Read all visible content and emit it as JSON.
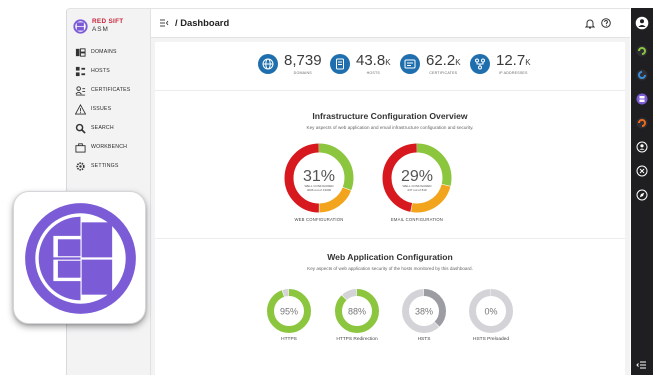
{
  "brand": {
    "name": "RED SIFT",
    "product": "ASM",
    "accent": "#c8253c",
    "logo_color": "#7b5cd6"
  },
  "sidebar": {
    "items": [
      {
        "label": "DOMAINS",
        "icon": "domains-icon"
      },
      {
        "label": "HOSTS",
        "icon": "hosts-icon"
      },
      {
        "label": "CERTIFICATES",
        "icon": "certificates-icon"
      },
      {
        "label": "ISSUES",
        "icon": "warning-icon"
      },
      {
        "label": "SEARCH",
        "icon": "search-icon"
      },
      {
        "label": "WORKBENCH",
        "icon": "workbench-icon"
      },
      {
        "label": "SETTINGS",
        "icon": "gear-icon"
      }
    ]
  },
  "header": {
    "breadcrumb": "/ Dashboard"
  },
  "stats": [
    {
      "value": "8,739",
      "suffix": "",
      "label": "DOMAINS",
      "icon": "globe-icon"
    },
    {
      "value": "43.8",
      "suffix": "K",
      "label": "HOSTS",
      "icon": "host-icon"
    },
    {
      "value": "62.2",
      "suffix": "K",
      "label": "CERTIFICATES",
      "icon": "certificate-icon"
    },
    {
      "value": "12.7",
      "suffix": "K",
      "label": "IP ADDRESSES",
      "icon": "network-icon"
    }
  ],
  "infra": {
    "title": "Infrastructure Configuration Overview",
    "subtitle": "Key aspects of web application and email infrastructure configuration and security.",
    "charts": [
      {
        "percent": "31%",
        "well_configured": 0.31,
        "mid_label": "WELL CONFIGURED",
        "detail": "4006 out of 13000",
        "caption": "WEB CONFIGURATION"
      },
      {
        "percent": "29%",
        "well_configured": 0.29,
        "mid_label": "WELL CONFIGURED",
        "detail": "237 out of 819",
        "caption": "EMAIL CONFIGURATION"
      }
    ]
  },
  "webapp": {
    "title": "Web Application Configuration",
    "subtitle": "Key aspects of web application security of the hosts monitored by this dashboard.",
    "rings": [
      {
        "percent": "95%",
        "value": 0.95,
        "label": "HTTPS"
      },
      {
        "percent": "88%",
        "value": 0.88,
        "label": "HTTPS Redirection"
      },
      {
        "percent": "38%",
        "value": 0.38,
        "label": "HSTS"
      },
      {
        "percent": "0%",
        "value": 0.0,
        "label": "HSTS Preloaded"
      }
    ]
  },
  "colors": {
    "green": "#8cc63f",
    "red": "#d7191f",
    "orange": "#f2a51c",
    "gray": "#9c9ca3",
    "lightgray": "#d4d4d8",
    "blue": "#1f6fae"
  }
}
